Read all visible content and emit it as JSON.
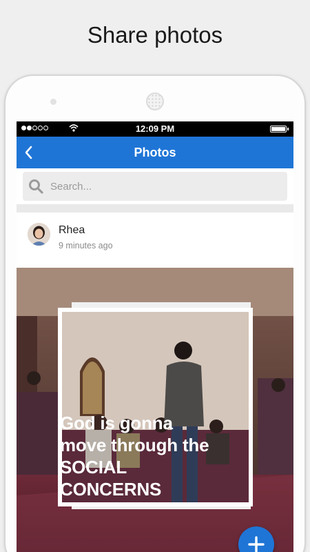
{
  "headline": "Share photos",
  "status_bar": {
    "time": "12:09 PM",
    "signal_icon": "signal-dots-icon",
    "wifi_icon": "wifi-icon",
    "battery_icon": "battery-icon"
  },
  "nav": {
    "title": "Photos",
    "back_icon": "chevron-left-icon"
  },
  "search": {
    "placeholder": "Search...",
    "value": "",
    "icon": "search-icon"
  },
  "post": {
    "author": "Rhea",
    "time_ago": "9 minutes ago",
    "caption_lines": [
      "God is gonna",
      "move through the",
      "SOCIAL",
      "CONCERNS"
    ]
  },
  "fab": {
    "icon": "plus-icon"
  },
  "colors": {
    "accent": "#1f75d6",
    "statusbar": "#000000",
    "background": "#efefef"
  }
}
